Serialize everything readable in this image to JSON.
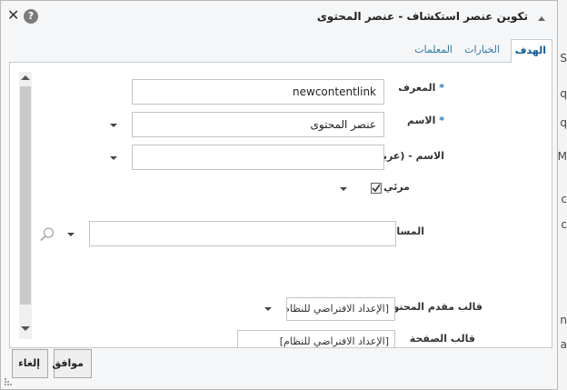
{
  "background": {
    "letters": [
      "S",
      "q",
      "q",
      "M",
      "c",
      "c",
      "n",
      "a"
    ]
  },
  "dialog": {
    "title": "تكوين عنصر استكشاف - عنصر المحتوى",
    "close_glyph": "✕",
    "help_glyph": "?"
  },
  "tabs": [
    {
      "label": "الهدف",
      "active": true
    },
    {
      "label": "الخيارات",
      "active": false
    },
    {
      "label": "المعلمات",
      "active": false
    }
  ],
  "form": {
    "id_label": "المعرف",
    "id_value": "newcontentlink",
    "name_label": "الاسم",
    "name_value": "عنصر المحتوى",
    "name_ar_label": "الاسم - (عربي)",
    "name_ar_value": "",
    "visible_label": "مرئي",
    "visible_checked": true,
    "path_label": "المسار",
    "path_value": "",
    "content_template_label": "قالب مقدم المحتوى",
    "content_template_value": "[الإعداد الافتراضي للنظام]",
    "page_template_label": "قالب الصفحة",
    "page_template_value": "[الإعداد الافتراضي للنظام]",
    "required_marker": "*"
  },
  "buttons": {
    "ok": "موافق",
    "cancel": "إلغاء"
  },
  "icons": {
    "close": "close-icon",
    "help": "help-icon",
    "search": "search-icon",
    "dropdown": "chevron-down-icon",
    "check": "checkmark-icon"
  }
}
